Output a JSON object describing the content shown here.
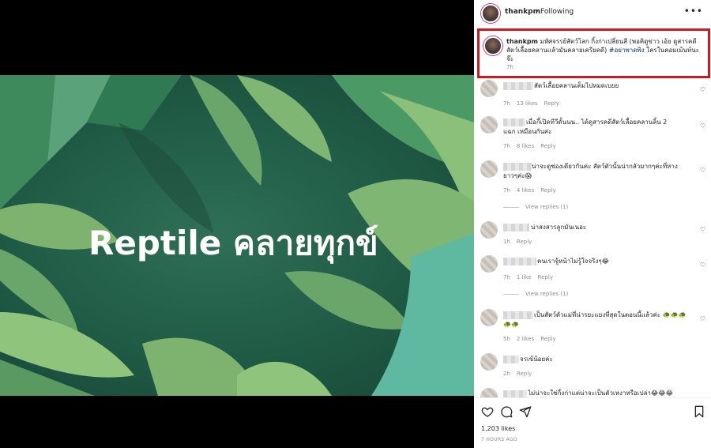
{
  "post": {
    "image_title": "Reptile คลายทุกข์",
    "header": {
      "username": "thankpm",
      "separator": "•",
      "follow_status": "Following",
      "more_label": "•••"
    },
    "caption": {
      "username": "thankpm",
      "text": "มหัศจรรย์สัตว์โลก กิ้งก่าเปลี่ยนสี (พอคิดูข่าว เอ้ย ดูสารคดีสัตว์เลื้อยคลานแล้วมันคลายเครียดดี)",
      "hashtag": "#อย่าพาดพิง",
      "text_after": "ใครในคอมเม้นท์นะจ๊ะ",
      "time": "7h"
    },
    "comments": [
      {
        "text": "สัตว์เลื้อยคลานเต็มไปหมดเบยย",
        "time": "7h",
        "likes": "13 likes",
        "reply": "Reply"
      },
      {
        "text": "เมื่อกี้เปิดทีวีดั้นนน.. ได้ดูสารคดีสัตว์เลื้อยคลานลิ้น 2 แฉก เหมือนกันค่ะ",
        "time": "7h",
        "likes": "8 likes",
        "reply": "Reply"
      },
      {
        "text": "น่าจะดูช่องเดียวกันค่ะ สัตว์ตัวนั้นน่ากลัวมากๆค่ะที่หางยาวๆค่ะ😱",
        "time": "7h",
        "likes": "4 likes",
        "reply": "Reply",
        "view_replies": "View replies (1)"
      },
      {
        "text": "น่าสงสารลูกมันเนอะ",
        "time": "1h",
        "reply": "Reply"
      },
      {
        "text": "คนเราจู้หน้าไม่รู้ใจจริงๆ😂",
        "time": "7h",
        "likes": "1 like",
        "reply": "Reply",
        "view_replies": "View replies (1)"
      },
      {
        "text": "เป็นสัตว์ตัวแม่ที่น่ารยะแยงที่สุดในตอนนี้แล้วค่ะ 🐢🐢🐢🐢🐢",
        "time": "5h",
        "likes": "2 likes",
        "reply": "Reply"
      },
      {
        "text": "จรเข้น้อยค่ะ",
        "time": "2h",
        "reply": "Reply"
      },
      {
        "text": "ไม่น่าจะใช่กิ้งก่าแต่น่าจะเป็นตัวเหงาหรือเปล่า😂😂😂",
        "time": "",
        "reply": ""
      }
    ],
    "likes_count": "1,203 likes",
    "posted_ago": "7 HOURS AGO"
  },
  "icons": [
    "heart-icon",
    "comment-icon",
    "share-icon",
    "bookmark-icon",
    "more-icon"
  ],
  "colors": {
    "highlight_border": "#d0191f",
    "hashtag": "#00376b",
    "background_green": "#1f5a45"
  }
}
